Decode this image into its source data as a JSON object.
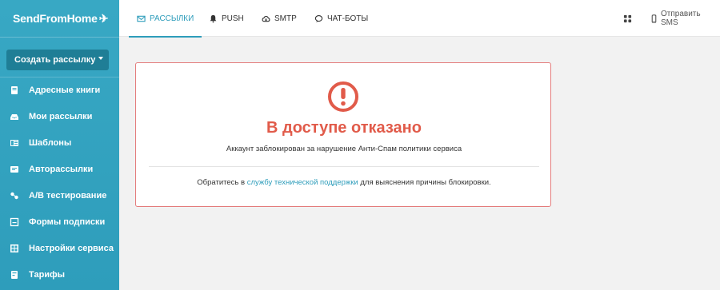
{
  "brand": {
    "name": "SendFromHome"
  },
  "sidebar": {
    "create_button": "Создать рассылку",
    "items": [
      {
        "label": "Адресные книги",
        "icon": "book-icon"
      },
      {
        "label": "Мои рассылки",
        "icon": "inbox-icon"
      },
      {
        "label": "Шаблоны",
        "icon": "template-icon"
      },
      {
        "label": "Авторассылки",
        "icon": "autoresponder-icon"
      },
      {
        "label": "A/B тестирование",
        "icon": "ab-test-icon"
      },
      {
        "label": "Формы подписки",
        "icon": "form-icon"
      },
      {
        "label": "Настройки сервиса",
        "icon": "settings-icon"
      },
      {
        "label": "Тарифы",
        "icon": "tariff-icon"
      }
    ]
  },
  "topnav": {
    "tabs": [
      {
        "label": "РАССЫЛКИ",
        "icon": "envelope-icon",
        "active": true
      },
      {
        "label": "PUSH",
        "icon": "bell-icon",
        "active": false
      },
      {
        "label": "SMTP",
        "icon": "cloud-icon",
        "active": false
      },
      {
        "label": "ЧАТ-БОТЫ",
        "icon": "chat-icon",
        "active": false
      }
    ],
    "send_sms": "Отправить SMS"
  },
  "alert": {
    "title": "В доступе отказано",
    "message": "Аккаунт заблокирован за нарушение Анти-Спам политики сервиса",
    "note_before": "Обратитесь в ",
    "note_link": "службу технической поддержки",
    "note_after": " для выяснения причины блокировки."
  },
  "colors": {
    "accent": "#2e9dbb",
    "error": "#e15b4a",
    "sidebar": "#38a8c4"
  }
}
